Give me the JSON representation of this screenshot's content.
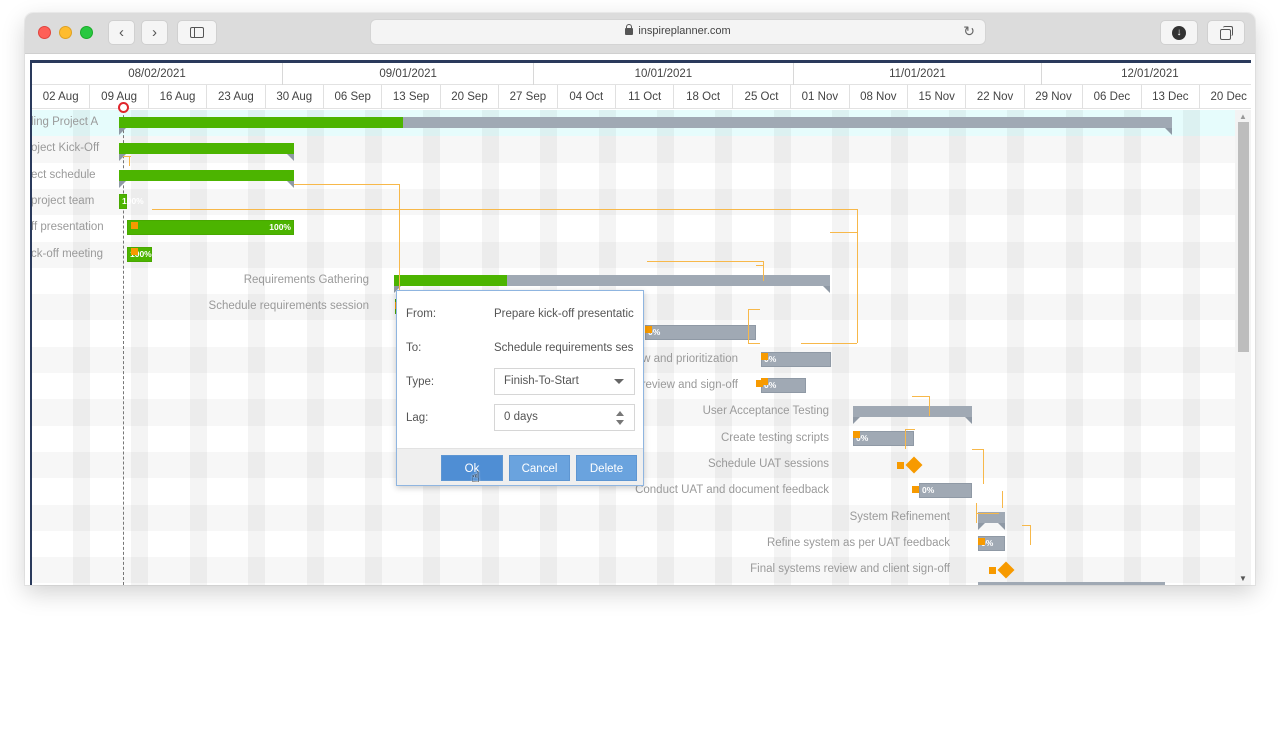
{
  "browser": {
    "url": "inspireplanner.com",
    "back_icon": "‹",
    "forward_icon": "›",
    "reload_icon": "↻",
    "download_icon": "↓"
  },
  "timeline": {
    "months": [
      "08/02/2021",
      "09/01/2021",
      "10/01/2021",
      "11/01/2021",
      "12/01/2021"
    ],
    "weeks": [
      "02 Aug",
      "09 Aug",
      "16 Aug",
      "23 Aug",
      "30 Aug",
      "06 Sep",
      "13 Sep",
      "20 Sep",
      "27 Sep",
      "04 Oct",
      "11 Oct",
      "18 Oct",
      "25 Oct",
      "01 Nov",
      "08 Nov",
      "15 Nov",
      "22 Nov",
      "29 Nov",
      "06 Dec",
      "13 Dec",
      "20 Dec"
    ]
  },
  "tasks": [
    {
      "name": "ling Project A",
      "type": "summary",
      "progress": 0.27
    },
    {
      "name": "oject Kick-Off",
      "type": "summary",
      "progress": 1.0
    },
    {
      "name": "ect schedule",
      "type": "summary",
      "progress": 1.0
    },
    {
      "name": "project team",
      "type": "task",
      "progress": 1.0,
      "pct_label": "100%"
    },
    {
      "name": "ff presentation",
      "type": "task",
      "progress": 1.0,
      "pct_label": "100%"
    },
    {
      "name": "ck-off meeting",
      "type": "task",
      "progress": 1.0,
      "pct_label": "100%"
    },
    {
      "name": "Requirements Gathering",
      "type": "summary",
      "progress": 0.26
    },
    {
      "name": "Schedule requirements session",
      "type": "task",
      "progress": 1.0,
      "pct_label": ""
    },
    {
      "name": "",
      "type": "task",
      "progress": 0,
      "pct_label": "0%"
    },
    {
      "name": "w and prioritization",
      "type": "task",
      "progress": 0,
      "pct_label": "0%"
    },
    {
      "name": "review and sign-off",
      "type": "task",
      "progress": 0,
      "pct_label": "0%"
    },
    {
      "name": "User Acceptance Testing",
      "type": "summary",
      "progress": 0
    },
    {
      "name": "Create testing scripts",
      "type": "task",
      "progress": 0,
      "pct_label": "0%"
    },
    {
      "name": "Schedule UAT sessions",
      "type": "milestone"
    },
    {
      "name": "Conduct UAT and document feedback",
      "type": "task",
      "progress": 0,
      "pct_label": "0%"
    },
    {
      "name": "System Refinement",
      "type": "summary",
      "progress": 0
    },
    {
      "name": "Refine system as per UAT feedback",
      "type": "task",
      "progress": 0,
      "pct_label": "0%"
    },
    {
      "name": "Final systems review and client sign-off",
      "type": "milestone"
    }
  ],
  "dialog": {
    "from_label": "From:",
    "from_value": "Prepare kick-off presentatic",
    "to_label": "To:",
    "to_value": "Schedule requirements ses:",
    "type_label": "Type:",
    "type_value": "Finish-To-Start",
    "lag_label": "Lag:",
    "lag_value": "0 days",
    "ok_label": "Ok",
    "cancel_label": "Cancel",
    "delete_label": "Delete"
  },
  "colors": {
    "complete": "#4cb400",
    "pending": "#a0a9b4",
    "dependency": "#f79a00",
    "today": "#e0262d",
    "header_border": "#2a3a5c"
  }
}
